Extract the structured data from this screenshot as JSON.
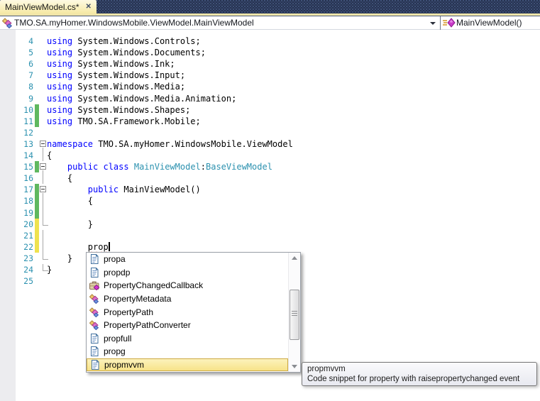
{
  "tab": {
    "title": "MainViewModel.cs*",
    "close_glyph": "✕"
  },
  "navbar": {
    "type_combo": {
      "icon": "class-icon",
      "value": "TMO.SA.myHomer.WindowsMobile.ViewModel.MainViewModel"
    },
    "member_combo": {
      "icon": "method-icon",
      "value": "MainViewModel()"
    }
  },
  "editor": {
    "lines": [
      {
        "num": 4,
        "bar": null,
        "outline": null,
        "segments": [
          {
            "color": "keyword",
            "text": "using"
          },
          {
            "color": "plain",
            "text": " System.Windows.Controls;"
          }
        ]
      },
      {
        "num": 5,
        "bar": null,
        "outline": null,
        "segments": [
          {
            "color": "keyword",
            "text": "using"
          },
          {
            "color": "plain",
            "text": " System.Windows.Documents;"
          }
        ]
      },
      {
        "num": 6,
        "bar": null,
        "outline": null,
        "segments": [
          {
            "color": "keyword",
            "text": "using"
          },
          {
            "color": "plain",
            "text": " System.Windows.Ink;"
          }
        ]
      },
      {
        "num": 7,
        "bar": null,
        "outline": null,
        "segments": [
          {
            "color": "keyword",
            "text": "using"
          },
          {
            "color": "plain",
            "text": " System.Windows.Input;"
          }
        ]
      },
      {
        "num": 8,
        "bar": null,
        "outline": null,
        "segments": [
          {
            "color": "keyword",
            "text": "using"
          },
          {
            "color": "plain",
            "text": " System.Windows.Media;"
          }
        ]
      },
      {
        "num": 9,
        "bar": null,
        "outline": null,
        "segments": [
          {
            "color": "keyword",
            "text": "using"
          },
          {
            "color": "plain",
            "text": " System.Windows.Media.Animation;"
          }
        ]
      },
      {
        "num": 10,
        "bar": "green",
        "outline": null,
        "segments": [
          {
            "color": "keyword",
            "text": "using"
          },
          {
            "color": "plain",
            "text": " System.Windows.Shapes;"
          }
        ]
      },
      {
        "num": 11,
        "bar": "green",
        "outline": null,
        "segments": [
          {
            "color": "keyword",
            "text": "using"
          },
          {
            "color": "plain",
            "text": " TMO.SA.Framework.Mobile;"
          }
        ]
      },
      {
        "num": 12,
        "bar": null,
        "outline": null,
        "segments": []
      },
      {
        "num": 13,
        "bar": null,
        "outline": "box",
        "segments": [
          {
            "color": "keyword",
            "text": "namespace"
          },
          {
            "color": "plain",
            "text": " TMO.SA.myHomer.WindowsMobile.ViewModel"
          }
        ]
      },
      {
        "num": 14,
        "bar": null,
        "outline": "guide",
        "segments": [
          {
            "color": "plain",
            "text": "{"
          }
        ]
      },
      {
        "num": 15,
        "bar": "green",
        "outline": "box",
        "segments": [
          {
            "color": "plain",
            "text": "    "
          },
          {
            "color": "keyword",
            "text": "public class"
          },
          {
            "color": "plain",
            "text": " "
          },
          {
            "color": "type",
            "text": "MainViewModel"
          },
          {
            "color": "plain",
            "text": ":"
          },
          {
            "color": "type",
            "text": "BaseViewModel"
          }
        ]
      },
      {
        "num": 16,
        "bar": null,
        "outline": "guide",
        "segments": [
          {
            "color": "plain",
            "text": "    {"
          }
        ]
      },
      {
        "num": 17,
        "bar": "green",
        "outline": "box",
        "segments": [
          {
            "color": "plain",
            "text": "        "
          },
          {
            "color": "keyword",
            "text": "public"
          },
          {
            "color": "plain",
            "text": " MainViewModel()"
          }
        ]
      },
      {
        "num": 18,
        "bar": "green",
        "outline": "guide",
        "segments": [
          {
            "color": "plain",
            "text": "        {"
          }
        ]
      },
      {
        "num": 19,
        "bar": "green",
        "outline": "guide",
        "segments": []
      },
      {
        "num": 20,
        "bar": "yellow",
        "outline": "tick",
        "segments": [
          {
            "color": "plain",
            "text": "        }"
          }
        ]
      },
      {
        "num": 21,
        "bar": "yellow",
        "outline": "guide",
        "segments": []
      },
      {
        "num": 22,
        "bar": "yellow",
        "outline": "guide",
        "segments": [
          {
            "color": "plain",
            "text": "        "
          },
          {
            "color": "plain",
            "text": "prop",
            "squiggle": true
          }
        ]
      },
      {
        "num": 23,
        "bar": null,
        "outline": "tick",
        "segments": [
          {
            "color": "plain",
            "text": "    }"
          }
        ]
      },
      {
        "num": 24,
        "bar": null,
        "outline": "tick",
        "segments": [
          {
            "color": "plain",
            "text": "}"
          }
        ]
      },
      {
        "num": 25,
        "bar": null,
        "outline": null,
        "segments": []
      }
    ]
  },
  "completion": {
    "items": [
      {
        "icon": "snippet-icon",
        "label": "propa",
        "selected": false
      },
      {
        "icon": "snippet-icon",
        "label": "propdp",
        "selected": false
      },
      {
        "icon": "delegate-icon",
        "label": "PropertyChangedCallback",
        "selected": false
      },
      {
        "icon": "class-icon",
        "label": "PropertyMetadata",
        "selected": false
      },
      {
        "icon": "class-icon",
        "label": "PropertyPath",
        "selected": false
      },
      {
        "icon": "class-icon",
        "label": "PropertyPathConverter",
        "selected": false
      },
      {
        "icon": "snippet-icon",
        "label": "propfull",
        "selected": false
      },
      {
        "icon": "snippet-icon",
        "label": "propg",
        "selected": false
      },
      {
        "icon": "snippet-icon",
        "label": "propmvvm",
        "selected": true
      }
    ]
  },
  "tooltip": {
    "title": "propmvvm",
    "description": "Code snippet for property with raisepropertychanged event"
  },
  "colors": {
    "keyword": "#0000FF",
    "type_name": "#2B91AF",
    "line_number": "#2B91AF",
    "change_saved": "#5FB85F",
    "change_unsaved": "#EFE24F",
    "tab_strip_bg": "#26334F",
    "active_tab_from": "#FEFAE3",
    "active_tab_to": "#F6E9A4",
    "selection_border": "#CDA942",
    "squiggle": "#E51400"
  }
}
